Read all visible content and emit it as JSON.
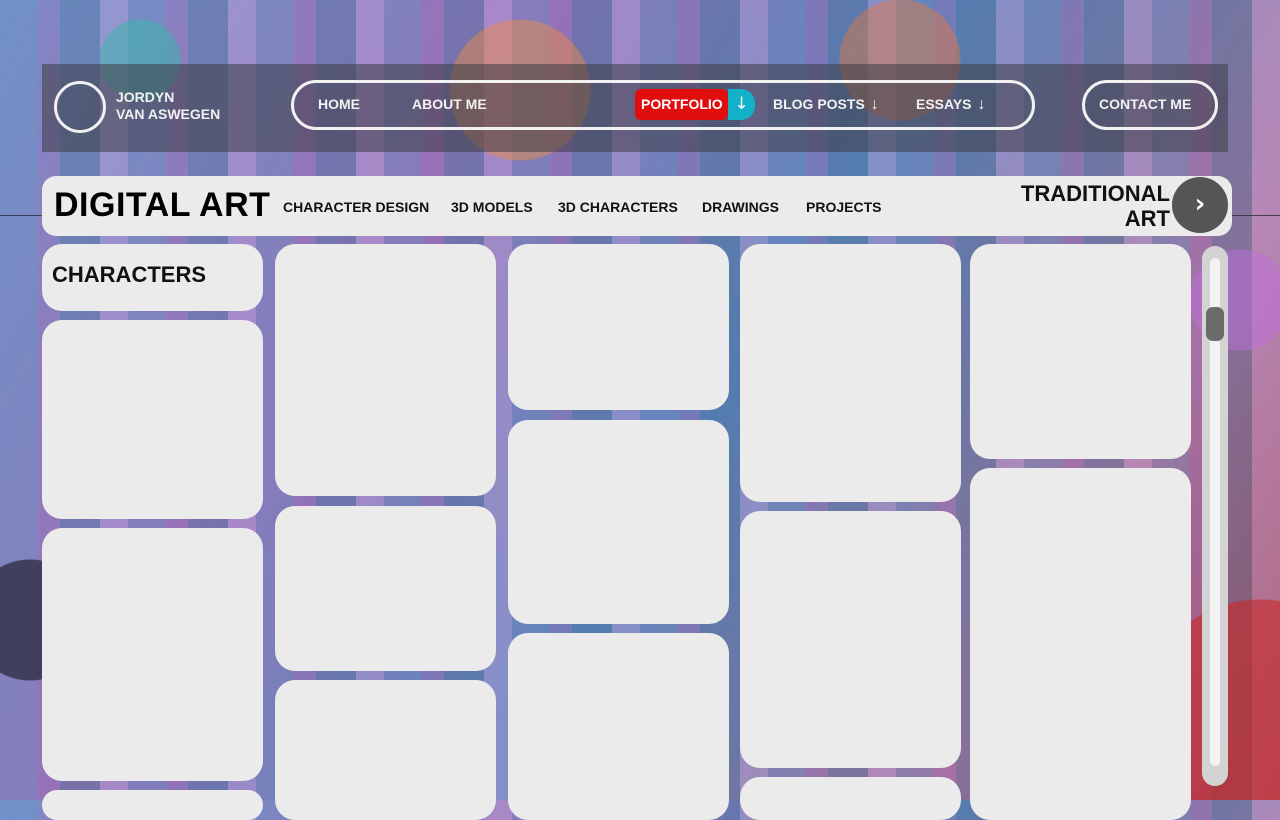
{
  "header": {
    "brand_line1": "JORDYN",
    "brand_line2": "VAN ASWEGEN",
    "nav": {
      "home": "HOME",
      "about": "ABOUT ME",
      "portfolio": "PORTFOLIO",
      "blog": "BLOG POSTS",
      "essays": "ESSAYS"
    },
    "contact": "CONTACT ME",
    "dropdown_arrow": "↓",
    "accent_red": "#e10e0e",
    "accent_teal": "#13b0c9"
  },
  "subnav": {
    "title": "DIGITAL ART",
    "links": [
      "CHARACTER DESIGN",
      "3D MODELS",
      "3D CHARACTERS",
      "DRAWINGS",
      "PROJECTS"
    ],
    "next_section_line1": "TRADITIONAL",
    "next_section_line2": "ART",
    "next_icon": "›"
  },
  "gallery": {
    "section_label": "CHARACTERS"
  }
}
